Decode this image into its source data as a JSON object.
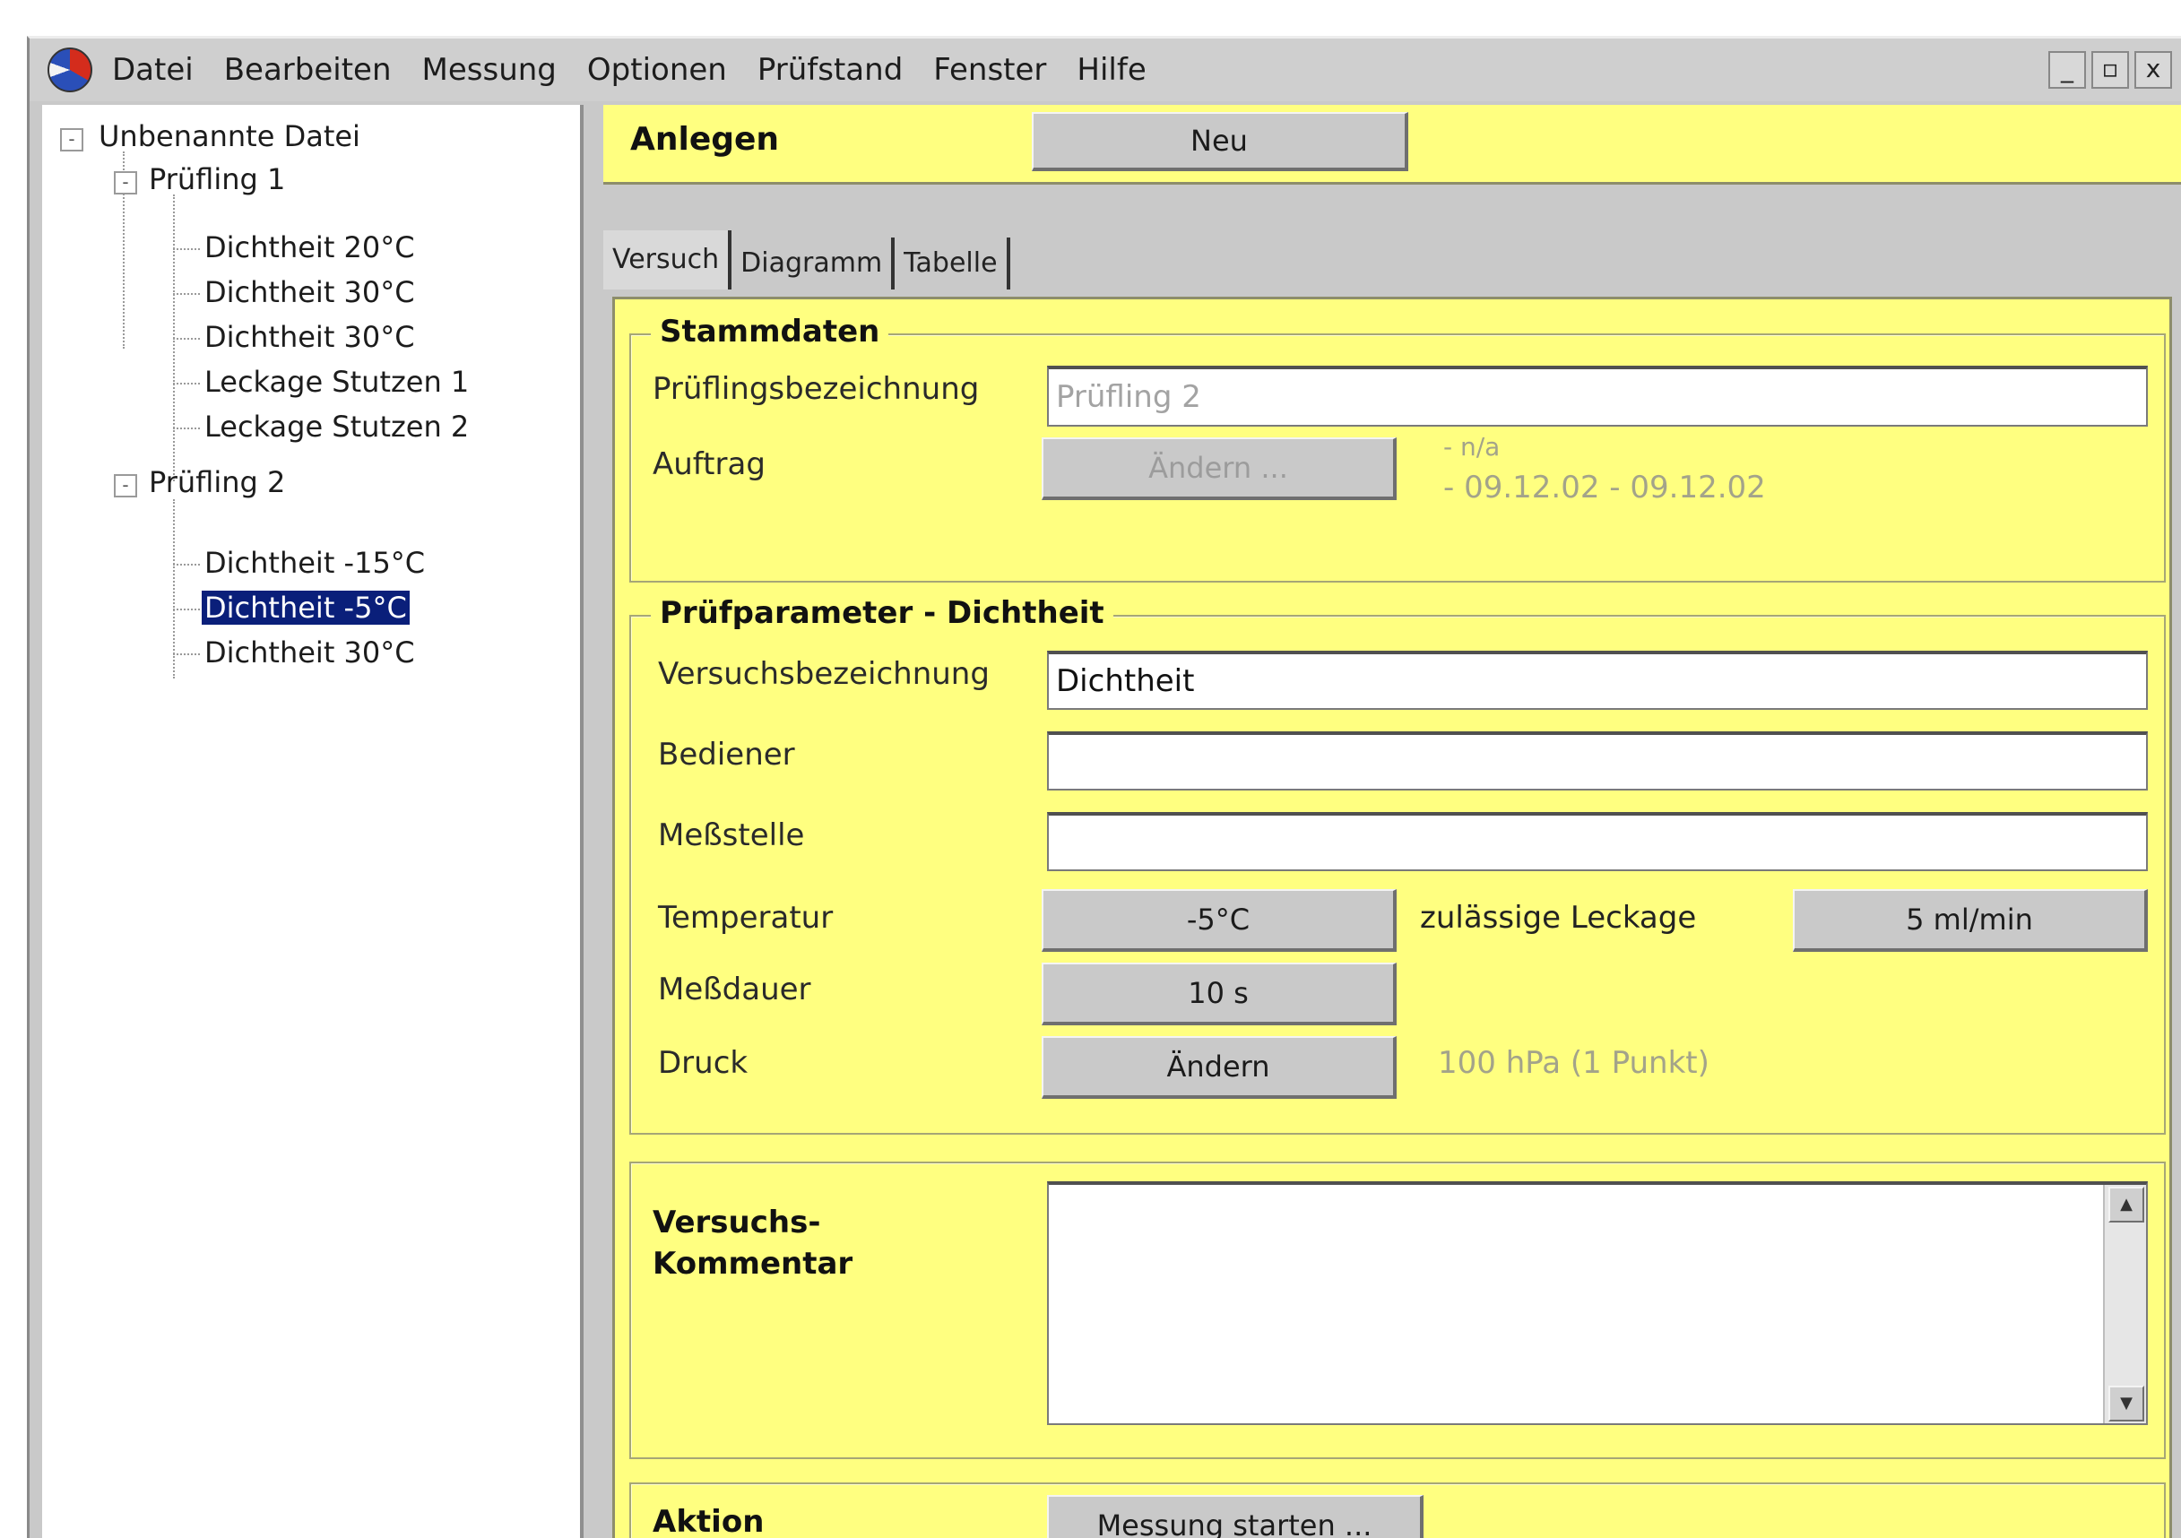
{
  "menu": {
    "items": [
      "Datei",
      "Bearbeiten",
      "Messung",
      "Optionen",
      "Prüfstand",
      "Fenster",
      "Hilfe"
    ],
    "window_controls": [
      "_",
      "▫",
      "x"
    ]
  },
  "tree": {
    "root": "Unbenannte Datei",
    "groups": [
      {
        "label": "Prüfling 1",
        "children": [
          "Dichtheit 20°C",
          "Dichtheit 30°C",
          "Dichtheit 30°C",
          "Leckage Stutzen 1",
          "Leckage Stutzen 2"
        ]
      },
      {
        "label": "Prüfling 2",
        "children": [
          "Dichtheit -15°C",
          "Dichtheit -5°C",
          "Dichtheit 30°C"
        ]
      }
    ],
    "selected": "Dichtheit -5°C"
  },
  "top_bar": {
    "label": "Anlegen",
    "new_button": "Neu"
  },
  "tabs": [
    "Versuch",
    "Diagramm",
    "Tabelle"
  ],
  "stammdaten": {
    "title": "Stammdaten",
    "pruefling_label": "Prüflingsbezeichnung",
    "pruefling_value": "Prüfling 2",
    "auftrag_label": "Auftrag",
    "auftrag_button": "Ändern ...",
    "auftrag_info_1": "- n/a",
    "auftrag_info_2": "- 09.12.02 - 09.12.02"
  },
  "pruefparameter": {
    "title": "Prüfparameter - Dichtheit",
    "versuch_label": "Versuchsbezeichnung",
    "versuch_value": "Dichtheit",
    "bediener_label": "Bediener",
    "bediener_value": "",
    "messstelle_label": "Meßstelle",
    "messstelle_value": "",
    "temperatur_label": "Temperatur",
    "temperatur_value": "-5°C",
    "leckage_label": "zulässige Leckage",
    "leckage_value": "5 ml/min",
    "messdauer_label": "Meßdauer",
    "messdauer_value": "10 s",
    "druck_label": "Druck",
    "druck_button": "Ändern",
    "druck_info": "100 hPa (1 Punkt)"
  },
  "kommentar": {
    "label_1": "Versuchs-",
    "label_2": "Kommentar",
    "value": ""
  },
  "aktion": {
    "label": "Aktion",
    "start_button": "Messung starten ..."
  }
}
